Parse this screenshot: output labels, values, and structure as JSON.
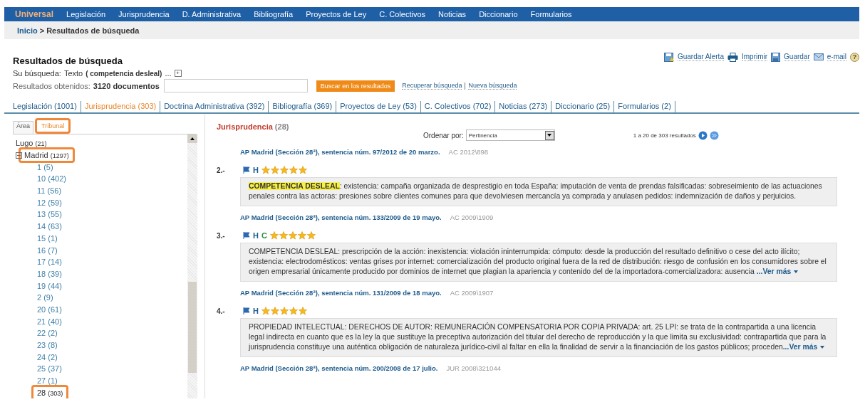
{
  "nav": [
    {
      "label": "Universal",
      "selected": true
    },
    {
      "label": "Legislación",
      "selected": false
    },
    {
      "label": "Jurisprudencia",
      "selected": false
    },
    {
      "label": "D. Administrativa",
      "selected": false
    },
    {
      "label": "Bibliografía",
      "selected": false
    },
    {
      "label": "Proyectos de Ley",
      "selected": false
    },
    {
      "label": "C. Colectivos",
      "selected": false
    },
    {
      "label": "Noticias",
      "selected": false
    },
    {
      "label": "Diccionario",
      "selected": false
    },
    {
      "label": "Formularios",
      "selected": false
    }
  ],
  "breadcrumb": {
    "home": "Inicio",
    "separator": ">",
    "current": "Resultados de búsqueda"
  },
  "actions": [
    {
      "kind": "alert",
      "label": "Guardar Alerta"
    },
    {
      "kind": "print",
      "label": "Imprimir"
    },
    {
      "kind": "save",
      "label": "Guardar"
    },
    {
      "kind": "mail",
      "label": "e-mail"
    },
    {
      "kind": "help",
      "label": "?"
    }
  ],
  "title": "Resultados de búsqueda",
  "query": {
    "label": "Su búsqueda:",
    "type": "Texto",
    "terms": "( competencia desleal)",
    "ellipsis": "...",
    "expand": "+"
  },
  "obtained": {
    "label": "Resultados obtenidos:",
    "count": "3120 documentos"
  },
  "search_button": "Buscar en los resultados",
  "links": [
    "Recuperar búsqueda",
    "Nueva búsqueda"
  ],
  "tabs": [
    {
      "label": "Legislación (1001)",
      "selected": false
    },
    {
      "label": "Jurisprudencia (303)",
      "selected": true
    },
    {
      "label": "Doctrina Administrativa (392)",
      "selected": false
    },
    {
      "label": "Bibliografía (369)",
      "selected": false
    },
    {
      "label": "Proyectos de Ley (53)",
      "selected": false
    },
    {
      "label": "C. Colectivos (702)",
      "selected": false
    },
    {
      "label": "Noticias (273)",
      "selected": false
    },
    {
      "label": "Diccionario (25)",
      "selected": false
    },
    {
      "label": "Formularios (2)",
      "selected": false
    }
  ],
  "facet_tabs": [
    {
      "label": "Área",
      "selected": false,
      "annotated": false
    },
    {
      "label": "Tribunal",
      "selected": true,
      "annotated": true
    }
  ],
  "tree": [
    {
      "label": "Lugo",
      "count": "(21)",
      "annotated": false
    },
    {
      "label": "Madrid",
      "count": "(1297)",
      "expanded": true,
      "annotated": true,
      "children": [
        {
          "label": "1",
          "count": "(5)",
          "selected": false,
          "annotated": false
        },
        {
          "label": "10",
          "count": "(402)",
          "selected": false,
          "annotated": false
        },
        {
          "label": "11",
          "count": "(56)",
          "selected": false,
          "annotated": false
        },
        {
          "label": "12",
          "count": "(59)",
          "selected": false,
          "annotated": false
        },
        {
          "label": "13",
          "count": "(55)",
          "selected": false,
          "annotated": false
        },
        {
          "label": "14",
          "count": "(63)",
          "selected": false,
          "annotated": false
        },
        {
          "label": "15",
          "count": "(1)",
          "selected": false,
          "annotated": false
        },
        {
          "label": "16",
          "count": "(7)",
          "selected": false,
          "annotated": false
        },
        {
          "label": "17",
          "count": "(14)",
          "selected": false,
          "annotated": false
        },
        {
          "label": "18",
          "count": "(39)",
          "selected": false,
          "annotated": false
        },
        {
          "label": "19",
          "count": "(44)",
          "selected": false,
          "annotated": false
        },
        {
          "label": "2",
          "count": "(9)",
          "selected": false,
          "annotated": false
        },
        {
          "label": "20",
          "count": "(61)",
          "selected": false,
          "annotated": false
        },
        {
          "label": "21",
          "count": "(40)",
          "selected": false,
          "annotated": false
        },
        {
          "label": "22",
          "count": "(2)",
          "selected": false,
          "annotated": false
        },
        {
          "label": "23",
          "count": "(8)",
          "selected": false,
          "annotated": false
        },
        {
          "label": "24",
          "count": "(2)",
          "selected": false,
          "annotated": false
        },
        {
          "label": "25",
          "count": "(37)",
          "selected": false,
          "annotated": false
        },
        {
          "label": "27",
          "count": "(1)",
          "selected": false,
          "annotated": false
        },
        {
          "label": "28",
          "count": "(303)",
          "selected": true,
          "annotated": true
        }
      ]
    }
  ],
  "results_header": {
    "title": "Jurisprudencia",
    "count": "(28)"
  },
  "sort": {
    "label": "Ordenar por:",
    "value": "Pertinencia"
  },
  "paging": {
    "text": "1 a 20 de 303 resultados"
  },
  "results": [
    {
      "citation": "AP Madrid (Sección 28ª), sentencia núm. 97/2012 de 20 marzo.",
      "ref": "AC 2012\\898"
    },
    {
      "number": "2.-",
      "badges": [
        "H"
      ],
      "stars": 5,
      "highlight": "COMPETENCIA DESLEAL",
      "summary": ": existencia: campaña organizada de desprestigio en toda España: imputación de venta de prendas falsificadas: sobreseimiento de las actuaciones penales contra las actoras: presiones sobre clientes comunes para que devolviesen mercancía ya comprada y anulasen pedidos: indemnización de daños y perjuicios.",
      "citation": "AP Madrid (Sección 28ª), sentencia núm. 133/2009 de 19 mayo.",
      "ref": "AC 2009\\1909"
    },
    {
      "number": "3.-",
      "badges": [
        "H",
        "C"
      ],
      "stars": 5,
      "summary": "COMPETENCIA DESLEAL: prescripción de la acción: inexistencia: violación ininterrumpida: cómputo: desde la producción del resultado definitivo o cese del acto ilícito; existencia: electrodomésticos: ventas grises por internet: comercialización del producto original fuera de la red de distribución: riesgo de confusión en los consumidores sobre el origen empresarial únicamente producido por dominios de internet que plagian la apariencia y contenido del de la importadora-comercializadora: ausencia ",
      "more": "...Ver más",
      "citation": "AP Madrid (Sección 28ª), sentencia núm. 131/2009 de 18 mayo.",
      "ref": "AC 2009\\1907"
    },
    {
      "number": "4.-",
      "badges": [
        "H"
      ],
      "stars": 5,
      "summary": "PROPIEDAD INTELECTUAL: DERECHOS DE AUTOR: REMUNERACIÓN COMPENSATORIA POR COPIA PRIVADA: art. 25 LPI: se trata de la contrapartida a una licencia legal indirecta en cuanto que es la ley la que sustituye la preceptiva autorización del titular del derecho de reproducción y la que limita su exclusividad: contrapartida que para la jurisprudencia constituye una auténtica obligación de naturaleza jurídico-civil al faltar en ella la finalidad de servir a la financiación de los gastos públicos; proceden",
      "more": "...Ver más",
      "citation": "AP Madrid (Sección 28ª), sentencia núm. 200/2008 de 17 julio.",
      "ref": "JUR 2008\\321044"
    }
  ]
}
